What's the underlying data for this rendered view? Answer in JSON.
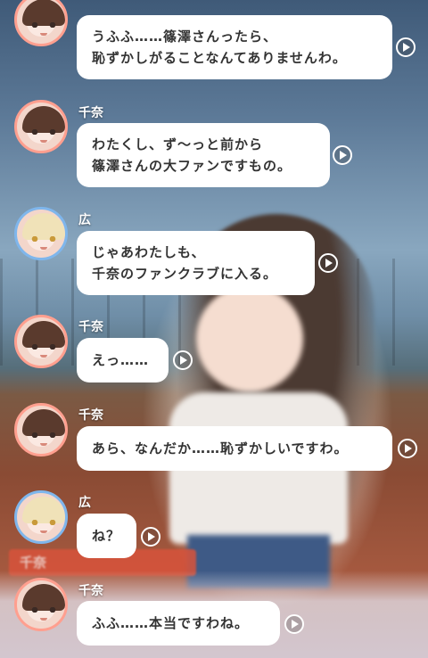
{
  "messages": [
    {
      "speaker": "",
      "avatar": "chinatsu",
      "lines": [
        "うふふ……篠澤さんったら、",
        "恥ずかしがることなんてありませんわ。"
      ]
    },
    {
      "speaker": "千奈",
      "avatar": "chinatsu",
      "lines": [
        "わたくし、ず～っと前から",
        "篠澤さんの大ファンですもの。"
      ]
    },
    {
      "speaker": "広",
      "avatar": "hiro",
      "lines": [
        "じゃあわたしも、",
        "千奈のファンクラブに入る。"
      ]
    },
    {
      "speaker": "千奈",
      "avatar": "chinatsu",
      "lines": [
        "えっ……"
      ]
    },
    {
      "speaker": "千奈",
      "avatar": "chinatsu",
      "lines": [
        "あら、なんだか……恥ずかしいですわ。"
      ]
    },
    {
      "speaker": "広",
      "avatar": "hiro",
      "lines": [
        "ね？"
      ]
    },
    {
      "speaker": "千奈",
      "avatar": "chinatsu",
      "lines": [
        "ふふ……本当ですわね。"
      ]
    }
  ],
  "background": {
    "nameplate": "千奈"
  },
  "colors": {
    "chinatsu_ring": "#ff9f8f",
    "hiro_ring": "#7fb6ec",
    "bubble": "#ffffff",
    "text": "#333333"
  }
}
